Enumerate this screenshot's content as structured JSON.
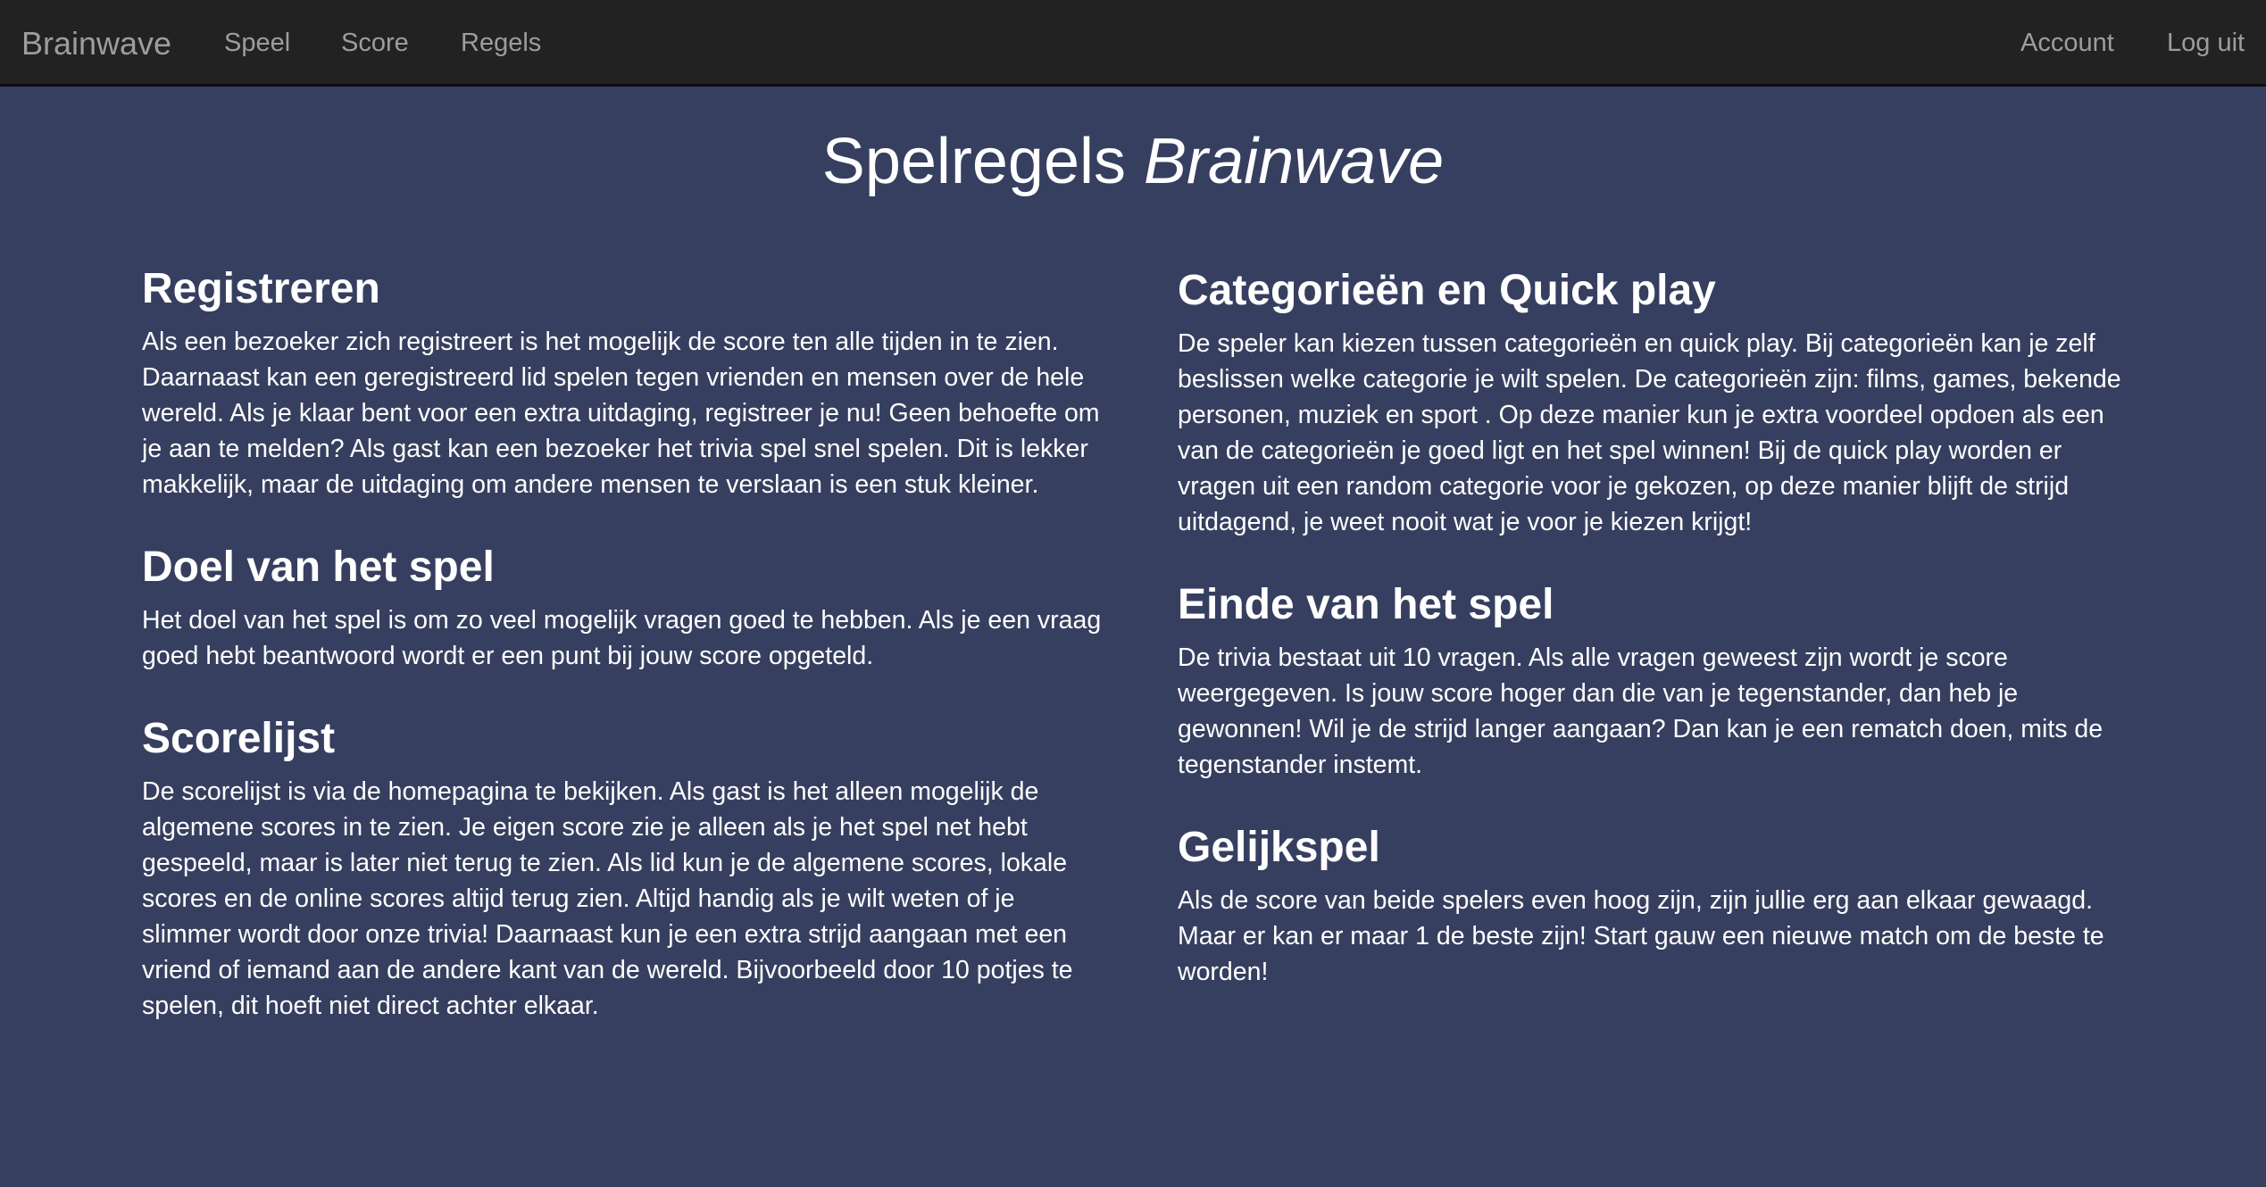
{
  "nav": {
    "brand": "Brainwave",
    "left_links": [
      "Speel",
      "Score",
      "Regels"
    ],
    "right_links": [
      "Account",
      "Log uit"
    ]
  },
  "title": {
    "prefix": "Spelregels",
    "emphasis": "Brainwave"
  },
  "sections": {
    "registreren": {
      "heading": "Registreren",
      "body": "Als een bezoeker zich registreert is het mogelijk de score ten alle tijden in te zien. Daarnaast kan een geregistreerd lid spelen tegen vrienden en mensen over de hele wereld. Als je klaar bent voor een extra uitdaging, registreer je nu! Geen behoefte om je aan te melden? Als gast kan een bezoeker het trivia spel snel spelen. Dit is lekker makkelijk, maar de uitdaging om andere mensen te verslaan is een stuk kleiner."
    },
    "doel": {
      "heading": "Doel van het spel",
      "body": "Het doel van het spel is om zo veel mogelijk vragen goed te hebben. Als je een vraag goed hebt beantwoord wordt er een punt bij jouw score opgeteld."
    },
    "scorelijst": {
      "heading": "Scorelijst",
      "body": "De scorelijst is via de homepagina te bekijken. Als gast is het alleen mogelijk de algemene scores in te zien. Je eigen score zie je alleen als je het spel net hebt gespeeld, maar is later niet terug te zien. Als lid kun je de algemene scores, lokale scores en de online scores altijd terug zien. Altijd handig als je wilt weten of je slimmer wordt door onze trivia! Daarnaast kun je een extra strijd aangaan met een vriend of iemand aan de andere kant van de wereld. Bijvoorbeeld door 10 potjes te spelen, dit hoeft niet direct achter elkaar."
    },
    "categorieen": {
      "heading": "Categorieën en Quick play",
      "body": "De speler kan kiezen tussen categorieën en quick play. Bij categorieën kan je zelf beslissen welke categorie je wilt spelen. De categorieën zijn: films, games, bekende personen, muziek en sport . Op deze manier kun je extra voordeel opdoen als een van de categorieën je goed ligt en het spel winnen! Bij de quick play worden er vragen uit een random categorie voor je gekozen, op deze manier blijft de strijd uitdagend, je weet nooit wat je voor je kiezen krijgt!"
    },
    "einde": {
      "heading": "Einde van het spel",
      "body": "De trivia bestaat uit 10 vragen. Als alle vragen geweest zijn wordt je score weergegeven. Is jouw score hoger dan die van je tegenstander, dan heb je gewonnen! Wil je de strijd langer aangaan? Dan kan je een rematch doen, mits de tegenstander instemt."
    },
    "gelijkspel": {
      "heading": "Gelijkspel",
      "body": "Als de score van beide spelers even hoog zijn, zijn jullie erg aan elkaar gewaagd. Maar er kan er maar 1 de beste zijn! Start gauw een nieuwe match om de beste te worden!"
    }
  },
  "colors": {
    "navbar": "#222222",
    "nav_text": "#9d9d9d",
    "page_background": "#363f5f",
    "text": "#ffffff"
  }
}
